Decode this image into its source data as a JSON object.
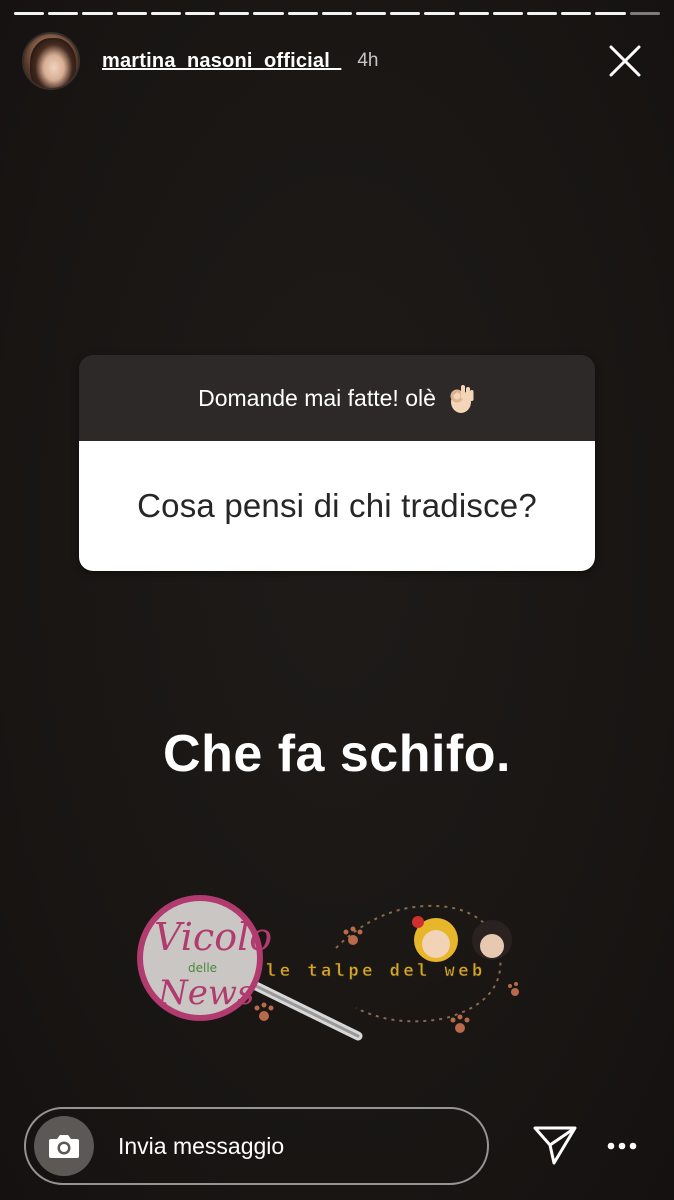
{
  "story": {
    "segments": 19,
    "active_segment": 17
  },
  "header": {
    "username": "martina_nasoni_official_",
    "time": "4h",
    "close_icon": "close-icon"
  },
  "question": {
    "title": "Domande mai fatte! olè",
    "title_emoji_icon": "ok-hand-icon",
    "text": "Cosa pensi di chi tradisce?"
  },
  "answer": "Che fa schifo.",
  "watermark": {
    "logo_text_top": "Vicolo",
    "logo_text_mid": "delle",
    "logo_text_bottom": "News",
    "tagline": "le talpe del web"
  },
  "footer": {
    "camera_icon": "camera-icon",
    "message_placeholder": "Invia messaggio",
    "send_icon": "send-icon",
    "more_icon": "more-icon"
  },
  "colors": {
    "background": "#181513",
    "card_header": "#2c2928",
    "card_body": "#ffffff",
    "watermark_pink": "#b13a6e"
  }
}
